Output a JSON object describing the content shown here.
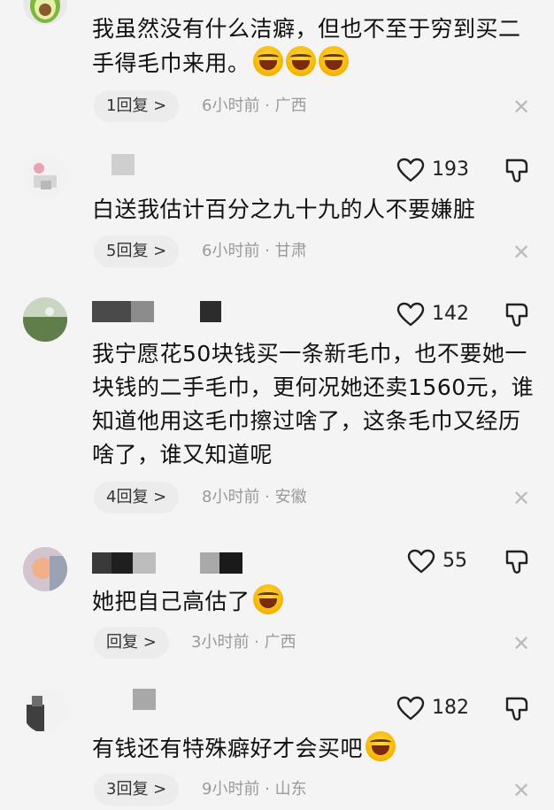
{
  "comments": [
    {
      "text": "我虽然没有什么洁癖，但也不至于穷到买二手得毛巾来用。",
      "emoji_count": 3,
      "reply_label": "1回复 >",
      "meta": "6小时前 · 广西"
    },
    {
      "likes": "193",
      "text": "白送我估计百分之九十九的人不要嫌脏",
      "reply_label": "5回复 >",
      "meta": "6小时前 · 甘肃"
    },
    {
      "likes": "142",
      "text": "我宁愿花50块钱买一条新毛巾，也不要她一块钱的二手毛巾，更何况她还卖1560元，谁知道他用这毛巾擦过啥了，这条毛巾又经历啥了，谁又知道呢",
      "reply_label": "4回复 >",
      "meta": "8小时前 · 安徽"
    },
    {
      "likes": "55",
      "text": "她把自己高估了",
      "emoji_count": 1,
      "reply_label": "回复 >",
      "meta": "3小时前 · 广西"
    },
    {
      "likes": "182",
      "text": "有钱还有特殊癖好才会买吧",
      "emoji_count": 1,
      "reply_label": "3回复 >",
      "meta": "9小时前 · 山东"
    }
  ],
  "icons": {
    "like": "heart-outline-icon",
    "dislike": "thumbs-down-icon",
    "close": "close-icon",
    "emoji": "laughing-crying-emoji"
  },
  "colors": {
    "background": "#f4f4f4",
    "text": "#111111",
    "meta": "#9a9a9a",
    "reply_pill": "#ececec",
    "emoji": "#f5b400"
  }
}
